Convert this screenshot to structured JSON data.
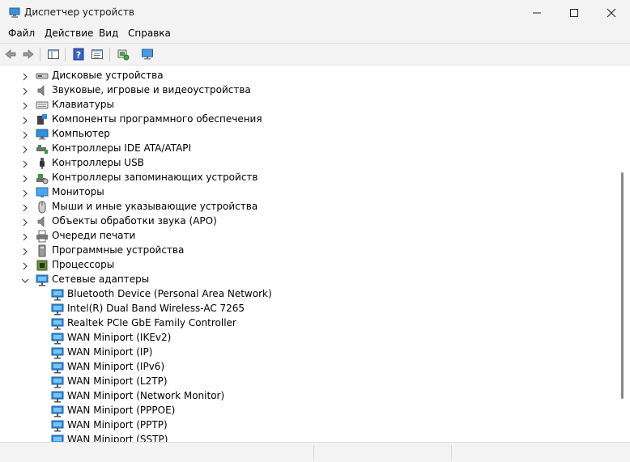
{
  "window": {
    "title": "Диспетчер устройств",
    "icon": "device-manager-icon"
  },
  "menu": [
    "Файл",
    "Действие",
    "Вид",
    "Справка"
  ],
  "toolbar": [
    "back-arrow-icon",
    "forward-arrow-icon",
    "properties-pane-icon",
    "help-icon",
    "properties-icon",
    "scan-hardware-icon",
    "monitor-icon"
  ],
  "tree": {
    "categories": [
      {
        "label": "Дисковые устройства",
        "icon": "disk-icon",
        "expanded": false
      },
      {
        "label": "Звуковые, игровые и видеоустройства",
        "icon": "speaker-icon",
        "expanded": false
      },
      {
        "label": "Клавиатуры",
        "icon": "keyboard-icon",
        "expanded": false
      },
      {
        "label": "Компоненты программного обеспечения",
        "icon": "software-component-icon",
        "expanded": false
      },
      {
        "label": "Компьютер",
        "icon": "computer-icon",
        "expanded": false
      },
      {
        "label": "Контроллеры IDE ATA/ATAPI",
        "icon": "ide-controller-icon",
        "expanded": false
      },
      {
        "label": "Контроллеры USB",
        "icon": "usb-icon",
        "expanded": false
      },
      {
        "label": "Контроллеры запоминающих устройств",
        "icon": "storage-controller-icon",
        "expanded": false
      },
      {
        "label": "Мониторы",
        "icon": "monitor-icon",
        "expanded": false
      },
      {
        "label": "Мыши и иные указывающие устройства",
        "icon": "mouse-icon",
        "expanded": false
      },
      {
        "label": "Объекты обработки звука (APO)",
        "icon": "audio-processing-icon",
        "expanded": false
      },
      {
        "label": "Очереди печати",
        "icon": "printer-icon",
        "expanded": false
      },
      {
        "label": "Программные устройства",
        "icon": "software-device-icon",
        "expanded": false
      },
      {
        "label": "Процессоры",
        "icon": "processor-icon",
        "expanded": false
      },
      {
        "label": "Сетевые адаптеры",
        "icon": "network-adapter-icon",
        "expanded": true
      }
    ],
    "network_adapters": [
      "Bluetooth Device (Personal Area Network)",
      "Intel(R) Dual Band Wireless-AC 7265",
      "Realtek PCIe GbE Family Controller",
      "WAN Miniport (IKEv2)",
      "WAN Miniport (IP)",
      "WAN Miniport (IPv6)",
      "WAN Miniport (L2TP)",
      "WAN Miniport (Network Monitor)",
      "WAN Miniport (PPPOE)",
      "WAN Miniport (PPTP)",
      "WAN Miniport (SSTP)"
    ]
  },
  "colors": {
    "chrome": "#f3f3f3",
    "network_icon": "#2f8fd8"
  }
}
